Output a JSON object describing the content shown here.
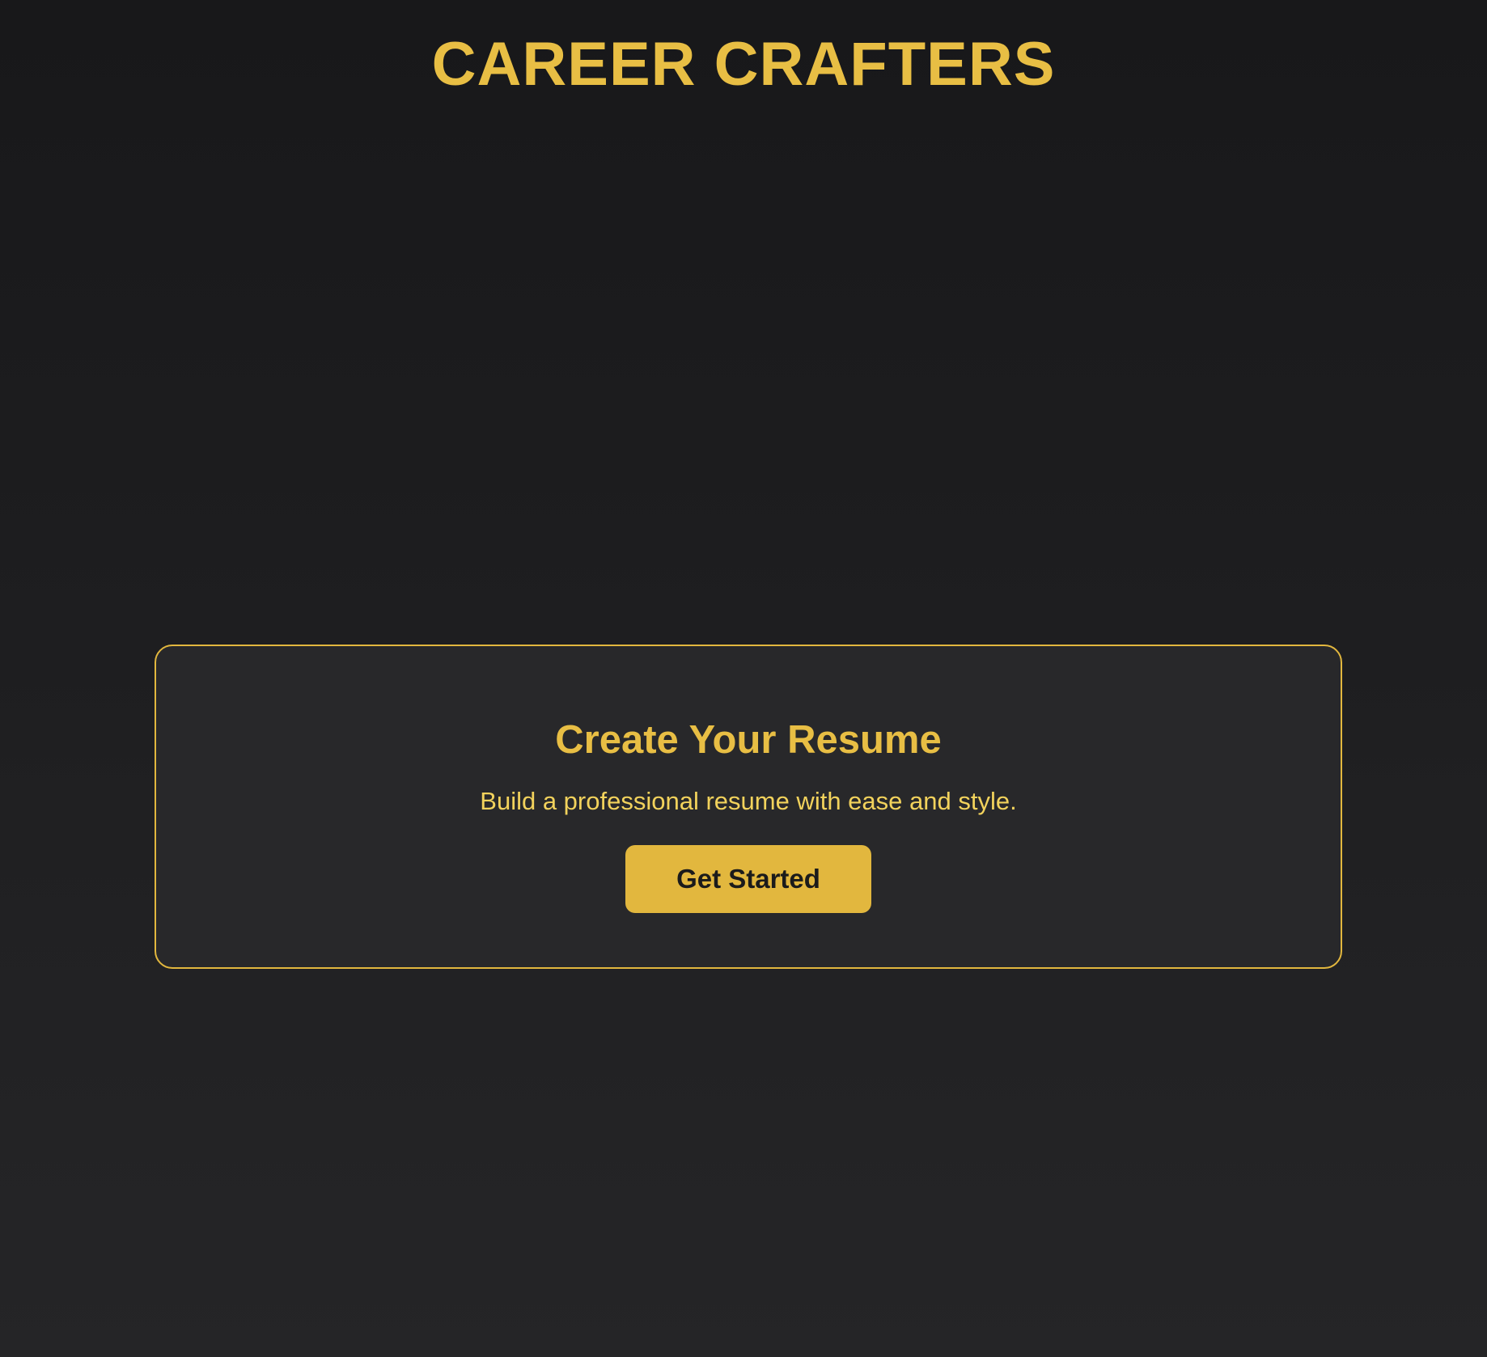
{
  "header": {
    "title": "CAREER CRAFTERS"
  },
  "card": {
    "title": "Create Your Resume",
    "subtitle": "Build a professional resume with ease and style.",
    "cta_label": "Get Started"
  },
  "colors": {
    "accent": "#e2b73e",
    "heading": "#e8be44",
    "subtitle": "#f2d25c",
    "button_bg": "#e2b73e",
    "button_text": "#1b1b1b",
    "card_bg": "#28282a",
    "page_bg": "#1e1e20"
  }
}
